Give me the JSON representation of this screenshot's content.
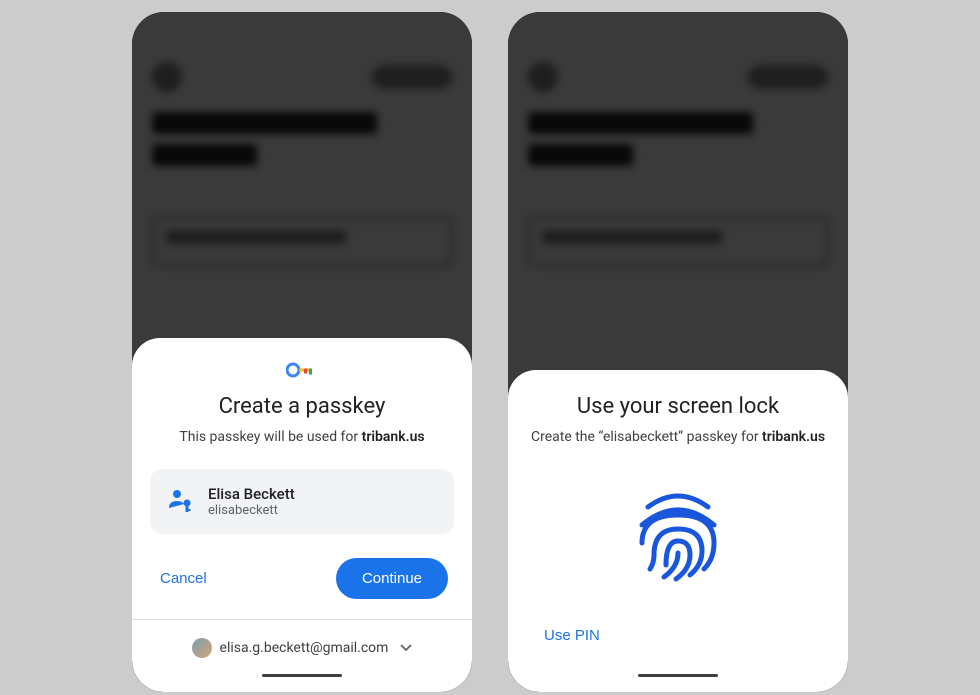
{
  "left": {
    "title": "Create a passkey",
    "subtitle_prefix": "This passkey will be used for ",
    "subtitle_domain": "tribank.us",
    "account": {
      "name": "Elisa Beckett",
      "username": "elisabeckett"
    },
    "buttons": {
      "cancel": "Cancel",
      "continue": "Continue"
    },
    "footer_email": "elisa.g.beckett@gmail.com"
  },
  "right": {
    "title": "Use your screen lock",
    "subtitle_prefix": "Create the “elisabeckett” passkey for ",
    "subtitle_domain": "tribank.us",
    "use_pin": "Use PIN"
  }
}
